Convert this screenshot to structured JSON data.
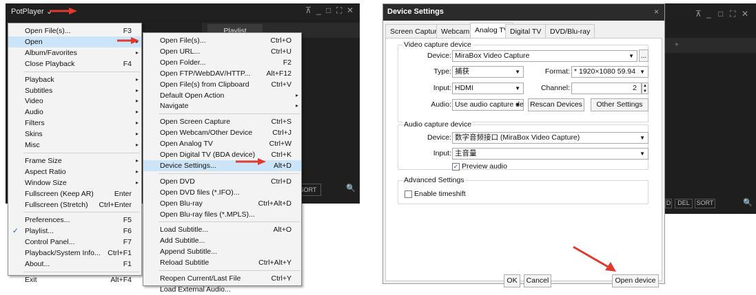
{
  "potplayer": {
    "title": "PotPlayer",
    "title_chevron": "⌄",
    "playlist_tab": "Playlist",
    "sort_btn": "SORT",
    "search": "🔍",
    "ctrls": [
      "⊼",
      "_",
      "□",
      "⛶",
      "✕"
    ]
  },
  "main_menu": [
    {
      "label": "Open File(s)...",
      "sc": "F3"
    },
    {
      "label": "Open",
      "arrow": "▸",
      "hl": true
    },
    {
      "label": "Album/Favorites",
      "arrow": "▸"
    },
    {
      "label": "Close Playback",
      "sc": "F4"
    },
    {
      "sep": true
    },
    {
      "label": "Playback",
      "arrow": "▸"
    },
    {
      "label": "Subtitles",
      "arrow": "▸"
    },
    {
      "label": "Video",
      "arrow": "▸"
    },
    {
      "label": "Audio",
      "arrow": "▸"
    },
    {
      "label": "Filters",
      "arrow": "▸"
    },
    {
      "label": "Skins",
      "arrow": "▸"
    },
    {
      "label": "Misc",
      "arrow": "▸"
    },
    {
      "sep": true
    },
    {
      "label": "Frame Size",
      "arrow": "▸"
    },
    {
      "label": "Aspect Ratio",
      "arrow": "▸"
    },
    {
      "label": "Window Size",
      "arrow": "▸"
    },
    {
      "label": "Fullscreen (Keep AR)",
      "sc": "Enter"
    },
    {
      "label": "Fullscreen (Stretch)",
      "sc": "Ctrl+Enter"
    },
    {
      "sep": true
    },
    {
      "label": "Preferences...",
      "sc": "F5"
    },
    {
      "label": "Playlist...",
      "sc": "F6",
      "check": "✓"
    },
    {
      "label": "Control Panel...",
      "sc": "F7"
    },
    {
      "label": "Playback/System Info...",
      "sc": "Ctrl+F1"
    },
    {
      "label": "About...",
      "sc": "F1"
    },
    {
      "sep": true
    },
    {
      "label": "Exit",
      "sc": "Alt+F4"
    }
  ],
  "open_menu": [
    {
      "label": "Open File(s)...",
      "sc": "Ctrl+O"
    },
    {
      "label": "Open URL...",
      "sc": "Ctrl+U"
    },
    {
      "label": "Open Folder...",
      "sc": "F2"
    },
    {
      "label": "Open FTP/WebDAV/HTTP...",
      "sc": "Alt+F12"
    },
    {
      "label": "Open File(s) from Clipboard",
      "sc": "Ctrl+V"
    },
    {
      "label": "Default Open Action",
      "arrow": "▸"
    },
    {
      "label": "Navigate",
      "arrow": "▸"
    },
    {
      "sep": true
    },
    {
      "label": "Open Screen Capture",
      "sc": "Ctrl+S"
    },
    {
      "label": "Open Webcam/Other Device",
      "sc": "Ctrl+J"
    },
    {
      "label": "Open Analog TV",
      "sc": "Ctrl+W"
    },
    {
      "label": "Open Digital TV (BDA device)",
      "sc": "Ctrl+K"
    },
    {
      "label": "Device Settings...",
      "sc": "Alt+D",
      "hl": true
    },
    {
      "sep": true
    },
    {
      "label": "Open DVD",
      "sc": "Ctrl+D"
    },
    {
      "label": "Open DVD files (*.IFO)..."
    },
    {
      "label": "Open Blu-ray",
      "sc": "Ctrl+Alt+D"
    },
    {
      "label": "Open Blu-ray files (*.MPLS)..."
    },
    {
      "sep": true
    },
    {
      "label": "Load Subtitle...",
      "sc": "Alt+O"
    },
    {
      "label": "Add Subtitle..."
    },
    {
      "label": "Append Subtitle..."
    },
    {
      "label": "Reload Subtitle",
      "sc": "Ctrl+Alt+Y"
    },
    {
      "sep": true
    },
    {
      "label": "Reopen Current/Last File",
      "sc": "Ctrl+Y"
    },
    {
      "label": "Load External Audio..."
    }
  ],
  "dialog": {
    "title": "Device Settings",
    "close": "×",
    "tabs": [
      "Screen Capture",
      "Webcam",
      "Analog TV",
      "Digital TV",
      "DVD/Blu-ray"
    ],
    "video_group": "Video capture device",
    "device_label": "Device:",
    "device_value": "MiraBox Video Capture",
    "more_btn": "...",
    "type_label": "Type:",
    "type_value": "捕获",
    "format_label": "Format:",
    "format_value": "* 1920×1080 59.94",
    "input_label": "Input:",
    "input_value": "HDMI",
    "channel_label": "Channel:",
    "channel_value": "2",
    "audio_label": "Audio:",
    "audio_value": "Use audio capture de",
    "rescan_btn": "Rescan Devices",
    "other_btn": "Other Settings",
    "audio_group": "Audio capture device",
    "a_device_label": "Device:",
    "a_device_value": "数字音频接口 (MiraBox Video Capture)",
    "a_input_label": "Input:",
    "a_input_value": "主音量",
    "preview_label": "Preview audio",
    "preview_check": "✓",
    "adv_group": "Advanced Settings",
    "timeshift_label": "Enable timeshift",
    "ok_btn": "OK",
    "cancel_btn": "Cancel",
    "open_btn": "Open device"
  },
  "bg_window": {
    "ctrls": [
      "⊼",
      "_",
      "□",
      "⛶",
      "✕"
    ],
    "plus": "+",
    "btns": [
      "D",
      "DEL",
      "SORT"
    ],
    "search": "🔍"
  },
  "colors": {
    "arrow": "#e03a2f",
    "highlight": "#cce4f7",
    "dark": "#1f1f1f"
  }
}
